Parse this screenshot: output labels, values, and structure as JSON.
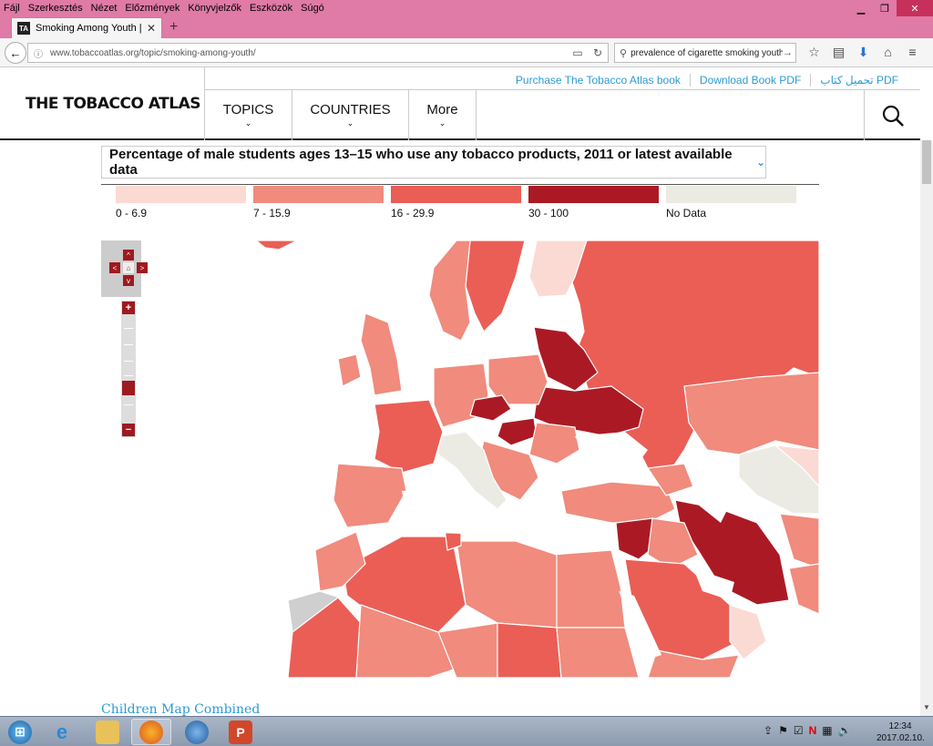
{
  "browser": {
    "menu": [
      "Fájl",
      "Szerkesztés",
      "Nézet",
      "Előzmények",
      "Könyvjelzők",
      "Eszközök",
      "Súgó"
    ],
    "tab_title": "Smoking Among Youth | ...",
    "tab_favicon": "TA",
    "url": "www.tobaccoatlas.org/topic/smoking-among-youth/",
    "search_value": "prevalence of cigarette smoking youth"
  },
  "site": {
    "logo": "THE TOBACCO ATLAS",
    "top_links": [
      "Purchase The Tobacco Atlas book",
      "Download Book PDF",
      "تحميل كتاب PDF"
    ],
    "nav": {
      "topics": "TOPICS",
      "countries": "COUNTRIES",
      "more": "More"
    }
  },
  "map_panel": {
    "dropdown_title": "Percentage of male students ages 13–15 who use any tobacco products, 2011 or latest available data",
    "legend": [
      {
        "label": "0 - 6.9",
        "color": "#fbdad4"
      },
      {
        "label": "7 - 15.9",
        "color": "#f08b7d"
      },
      {
        "label": "16 - 29.9",
        "color": "#ea5e56"
      },
      {
        "label": "30 - 100",
        "color": "#ab1a24"
      },
      {
        "label": "No Data",
        "color": "#ecebe3"
      }
    ],
    "controls": {
      "pan_up": "^",
      "pan_left": "<",
      "pan_home": "⌂",
      "pan_right": ">",
      "pan_down": "v",
      "zoom_in": "+",
      "zoom_out": "−"
    }
  },
  "footer_link": "Children Map Combined",
  "taskbar": {
    "clock_time": "12:34",
    "clock_date": "2017.02.10."
  }
}
